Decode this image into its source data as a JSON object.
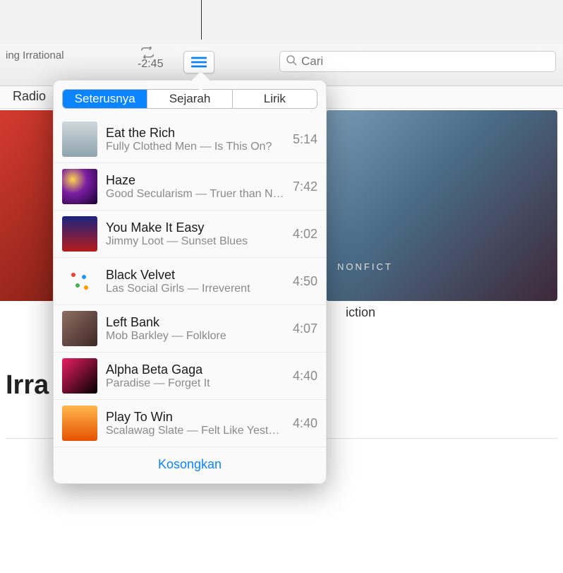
{
  "colors": {
    "accent": "#0b84ff"
  },
  "toolbar": {
    "now_playing_subtitle": "ing Irrational",
    "time_remaining": "-2:45",
    "search_placeholder": "Cari"
  },
  "page_tab": "Radio",
  "background": {
    "album_label_right": "iction",
    "heading": "Irra",
    "nonfiction_text": "NONFICT"
  },
  "popover": {
    "tabs": [
      {
        "label": "Seterusnya",
        "active": true
      },
      {
        "label": "Sejarah",
        "active": false
      },
      {
        "label": "Lirik",
        "active": false
      }
    ],
    "queue": [
      {
        "title": "Eat the Rich",
        "artist_album": "Fully Clothed Men — Is This On?",
        "duration": "5:14"
      },
      {
        "title": "Haze",
        "artist_album": "Good Secularism — Truer than N…",
        "duration": "7:42"
      },
      {
        "title": "You Make It Easy",
        "artist_album": "Jimmy Loot — Sunset Blues",
        "duration": "4:02"
      },
      {
        "title": "Black Velvet",
        "artist_album": "Las Social Girls — Irreverent",
        "duration": "4:50"
      },
      {
        "title": "Left Bank",
        "artist_album": "Mob Barkley — Folklore",
        "duration": "4:07"
      },
      {
        "title": "Alpha Beta Gaga",
        "artist_album": "Paradise — Forget It",
        "duration": "4:40"
      },
      {
        "title": "Play To Win",
        "artist_album": "Scalawag Slate — Felt Like Yeste…",
        "duration": "4:40"
      }
    ],
    "clear_label": "Kosongkan"
  }
}
